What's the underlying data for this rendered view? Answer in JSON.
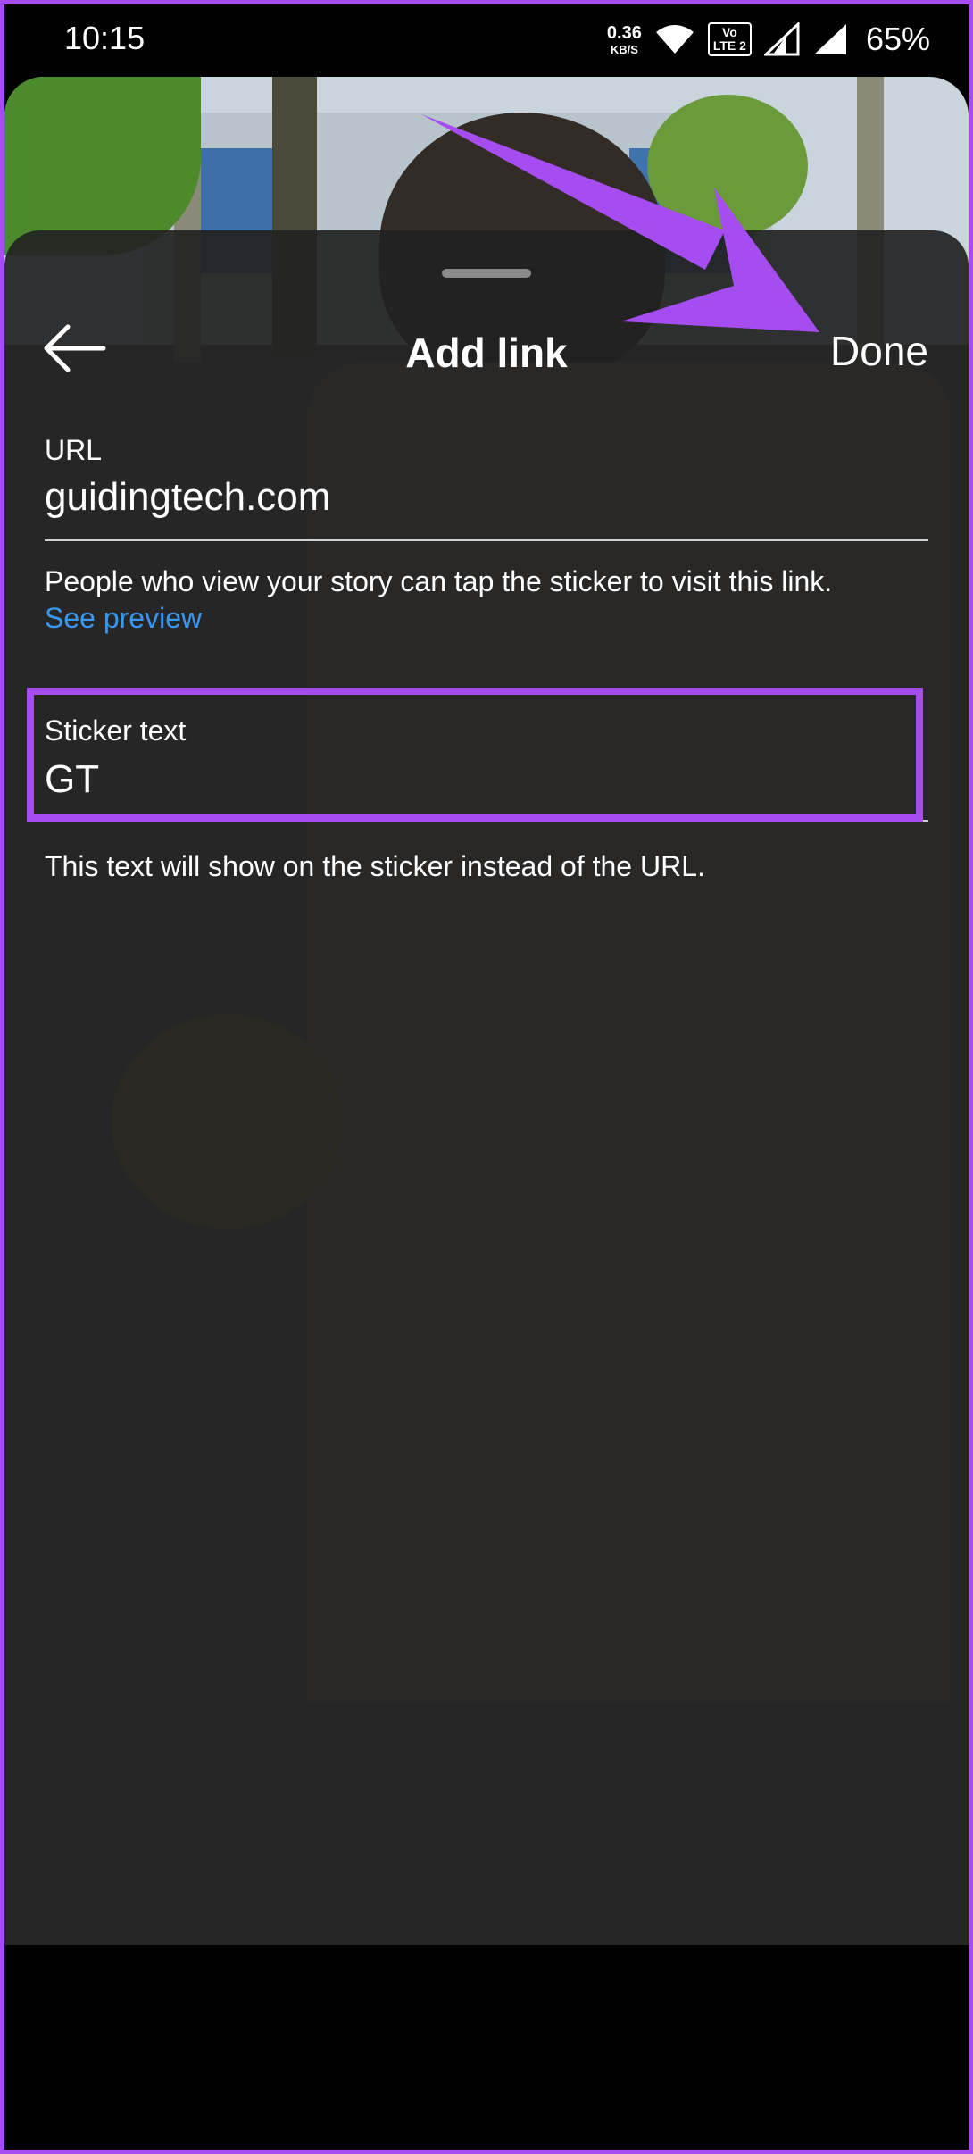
{
  "status_bar": {
    "time": "10:15",
    "net_speed_value": "0.36",
    "net_speed_unit": "KB/S",
    "volte_top": "Vo",
    "volte_bottom": "LTE 2",
    "battery": "65%"
  },
  "header": {
    "title": "Add link",
    "done_label": "Done"
  },
  "url_field": {
    "label": "URL",
    "value": "guidingtech.com",
    "helper": "People who view your story can tap the sticker to visit this link.",
    "preview_link": "See preview"
  },
  "sticker_field": {
    "label": "Sticker text",
    "value": "GT",
    "helper": "This text will show on the sticker instead of the URL."
  },
  "colors": {
    "annotation": "#a64df2",
    "link": "#3897f0",
    "sheet": "#222222"
  },
  "icons": [
    "back-arrow-icon",
    "wifi-icon",
    "signal-icon"
  ]
}
